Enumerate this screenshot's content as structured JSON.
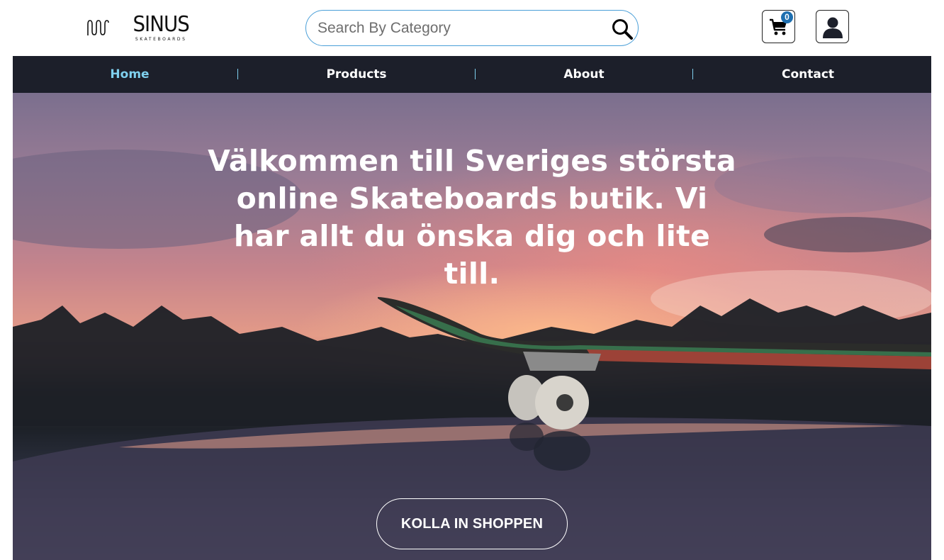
{
  "brand": {
    "name": "SINUS",
    "tagline": "SKATEBOARDS"
  },
  "search": {
    "placeholder": "Search By Category",
    "value": ""
  },
  "cart": {
    "count": "0"
  },
  "nav": {
    "items": [
      {
        "label": "Home",
        "active": true
      },
      {
        "label": "Products",
        "active": false
      },
      {
        "label": "About",
        "active": false
      },
      {
        "label": "Contact",
        "active": false
      }
    ]
  },
  "hero": {
    "title": "Välkommen till Sveriges största online Skateboards butik. Vi har allt du önska dig och lite till.",
    "cta_label": "KOLLA IN SHOPPEN"
  },
  "colors": {
    "nav_bg": "#1c1f2a",
    "nav_active": "#7fd0ee",
    "search_border": "#4a9fd8",
    "cart_badge": "#1e6fb0"
  },
  "icons": {
    "logo": "wave-logo-icon",
    "search": "search-icon",
    "cart": "cart-icon",
    "user": "user-icon"
  }
}
